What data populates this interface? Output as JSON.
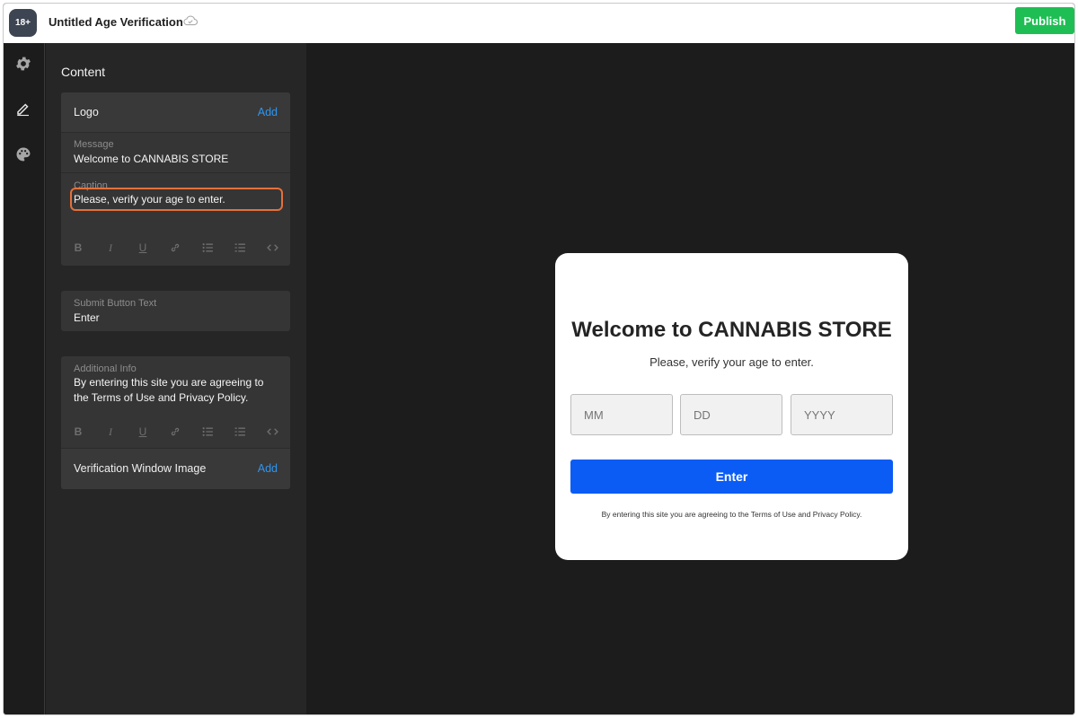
{
  "topbar": {
    "app_badge": "18+",
    "doc_title": "Untitled Age Verification",
    "cloud_icon": "cloud-check-icon",
    "publish_label": "Publish",
    "publish_color": "#1fbe54"
  },
  "rail": {
    "items": [
      {
        "icon": "gear-icon"
      },
      {
        "icon": "pen-icon"
      },
      {
        "icon": "palette-icon"
      }
    ]
  },
  "panel": {
    "title": "Content",
    "logo": {
      "label": "Logo",
      "action": "Add"
    },
    "message": {
      "label": "Message",
      "value": "Welcome to CANNABIS STORE"
    },
    "caption": {
      "label": "Caption",
      "value": "Please, verify your age to enter."
    },
    "toolbar_icons": [
      "bold-icon",
      "italic-icon",
      "underline-icon",
      "link-icon",
      "bullet-list-icon",
      "numbered-list-icon",
      "code-icon"
    ],
    "submit": {
      "label": "Submit Button Text",
      "value": "Enter"
    },
    "additional": {
      "label": "Additional Info",
      "value": "By entering this site you are agreeing to the Terms of Use and Privacy Policy."
    },
    "window_image": {
      "label": "Verification Window Image",
      "action": "Add"
    },
    "accent_color": "#2f95ef",
    "highlight_color": "#e4713a"
  },
  "preview": {
    "title": "Welcome to CANNABIS STORE",
    "caption": "Please, verify your age to enter.",
    "placeholders": {
      "month": "MM",
      "day": "DD",
      "year": "YYYY"
    },
    "button_label": "Enter",
    "button_color": "#0a5cf5",
    "info": "By entering this site you are agreeing to the Terms of Use and Privacy Policy."
  }
}
